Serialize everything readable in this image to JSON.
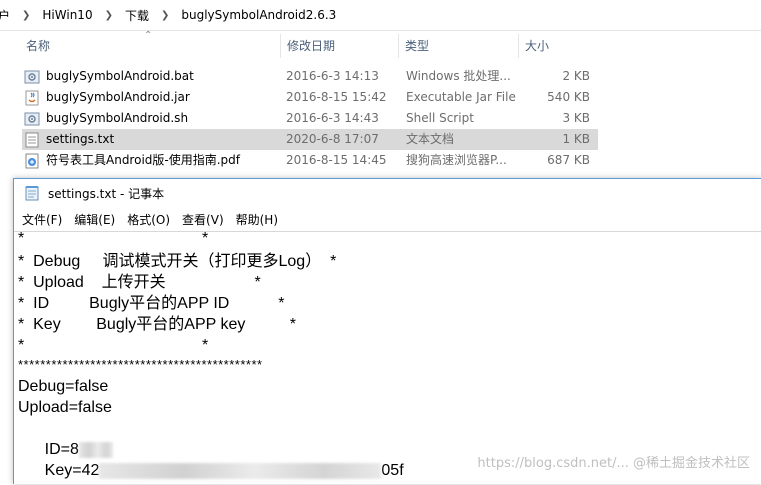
{
  "explorer": {
    "breadcrumb": [
      "户",
      "HiWin10",
      "下载",
      "buglySymbolAndroid2.6.3"
    ],
    "columns": {
      "name": "名称",
      "date": "修改日期",
      "type": "类型",
      "size": "大小"
    },
    "files": [
      {
        "name": "buglySymbolAndroid.bat",
        "date": "2016-6-3 14:13",
        "type": "Windows 批处理...",
        "size": "2 KB",
        "icon": "bat-file-icon",
        "selected": false
      },
      {
        "name": "buglySymbolAndroid.jar",
        "date": "2016-8-15 15:42",
        "type": "Executable Jar File",
        "size": "540 KB",
        "icon": "jar-file-icon",
        "selected": false
      },
      {
        "name": "buglySymbolAndroid.sh",
        "date": "2016-6-3 14:43",
        "type": "Shell Script",
        "size": "3 KB",
        "icon": "sh-file-icon",
        "selected": false
      },
      {
        "name": "settings.txt",
        "date": "2020-6-8 17:07",
        "type": "文本文档",
        "size": "1 KB",
        "icon": "text-file-icon",
        "selected": true
      },
      {
        "name": "符号表工具Android版-使用指南.pdf",
        "date": "2016-8-15 14:45",
        "type": "搜狗高速浏览器P...",
        "size": "687 KB",
        "icon": "pdf-file-icon",
        "selected": false
      }
    ]
  },
  "notepad": {
    "title": "settings.txt - 记事本",
    "menu": [
      "文件(F)",
      "编辑(E)",
      "格式(O)",
      "查看(V)",
      "帮助(H)"
    ],
    "lines": [
      "*                                        *",
      "*  Debug     调试模式开关（打印更多Log）  *",
      "*  Upload    上传开关                    *",
      "*  ID         Bugly平台的APP ID           *",
      "*  Key        Bugly平台的APP key          *",
      "*                                        *",
      "********************************************",
      "Debug=false",
      "Upload=false"
    ],
    "id_prefix": "ID=8",
    "key_prefix": "Key=42",
    "key_suffix": "05f"
  },
  "watermark": "https://blog.csdn.net/... @稀土掘金技术社区",
  "colors": {
    "selected_row": "#d9d9d9",
    "header_text": "#4c607a",
    "window_border": "#5b9bd5"
  }
}
